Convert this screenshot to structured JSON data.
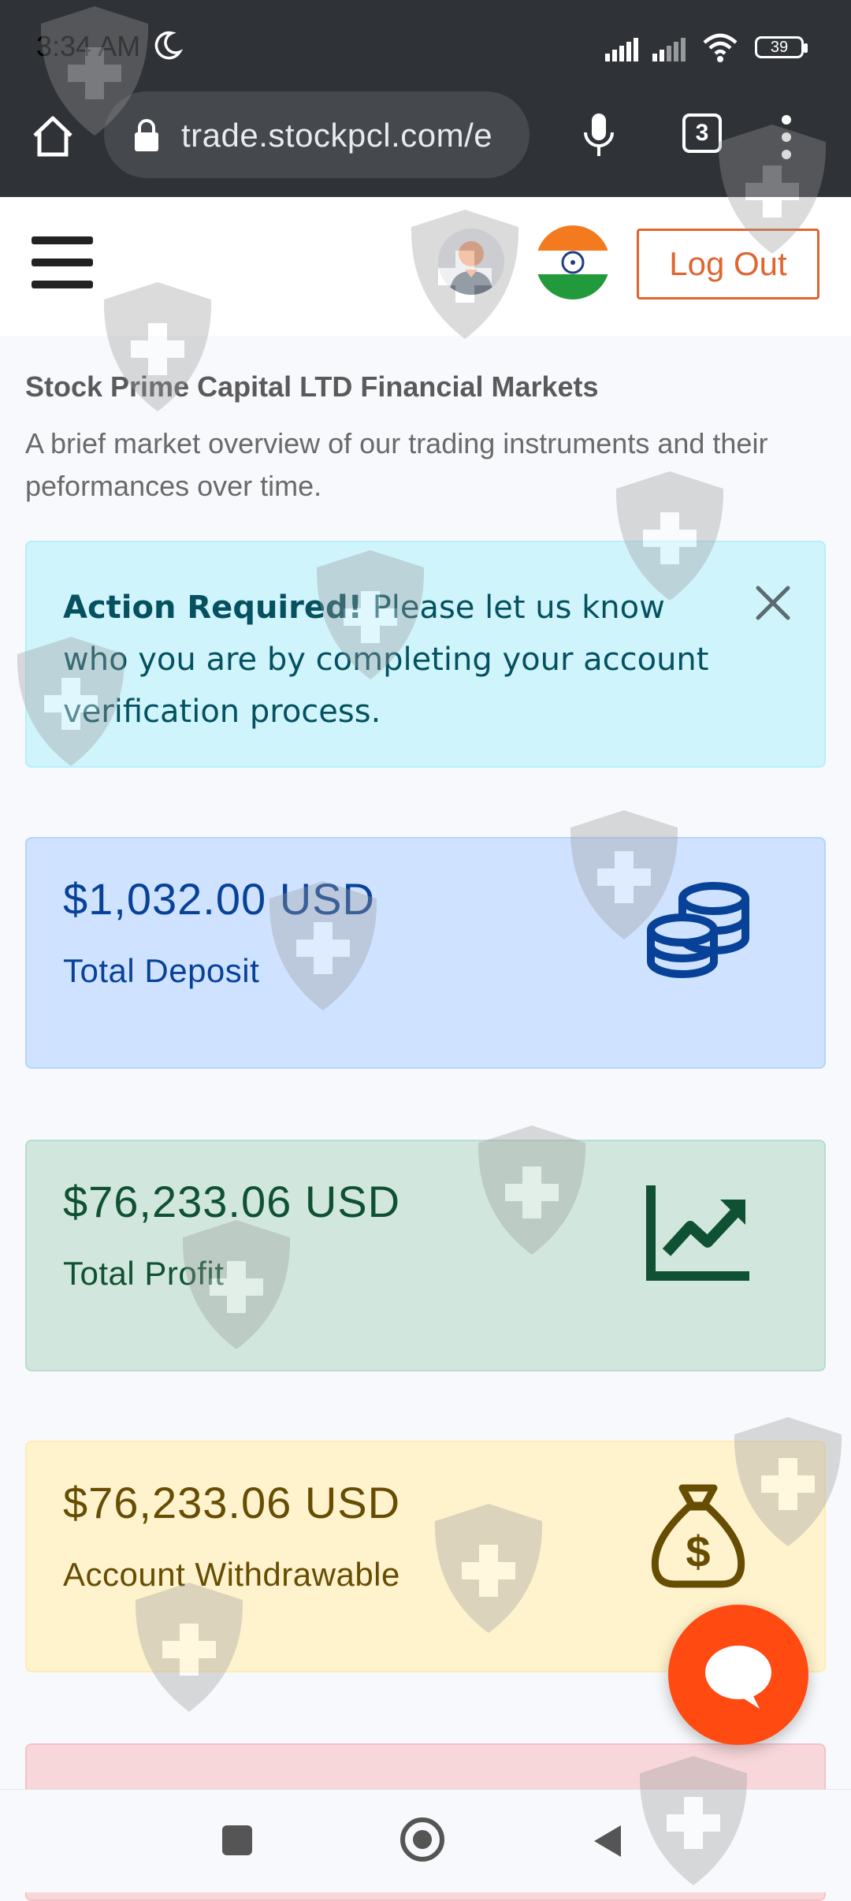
{
  "status_bar": {
    "time": "3:34 AM",
    "battery": "39"
  },
  "browser": {
    "url": "trade.stockpcl.com/e",
    "tab_count": "3"
  },
  "header": {
    "logout_label": "Log Out",
    "flag": "india-flag",
    "avatar": "user-avatar"
  },
  "page": {
    "title": "Stock Prime Capital LTD Financial Markets",
    "description": "A brief market overview of our trading instruments and their peformances over time."
  },
  "alert": {
    "strong": "Action Required!",
    "message": " Please let us know who you are by completing your account verification process."
  },
  "cards": [
    {
      "amount": "$1,032.00 USD",
      "label": "Total Deposit",
      "icon": "coins-icon",
      "color": "#084298"
    },
    {
      "amount": "$76,233.06 USD",
      "label": "Total Profit",
      "icon": "chart-line-icon",
      "color": "#0f5132"
    },
    {
      "amount": "$76,233.06 USD",
      "label": "Account Withdrawable",
      "icon": "money-bag-icon",
      "color": "#664d03"
    }
  ],
  "colors": {
    "accent": "#e06631",
    "chat_fab": "#ff4a12"
  }
}
